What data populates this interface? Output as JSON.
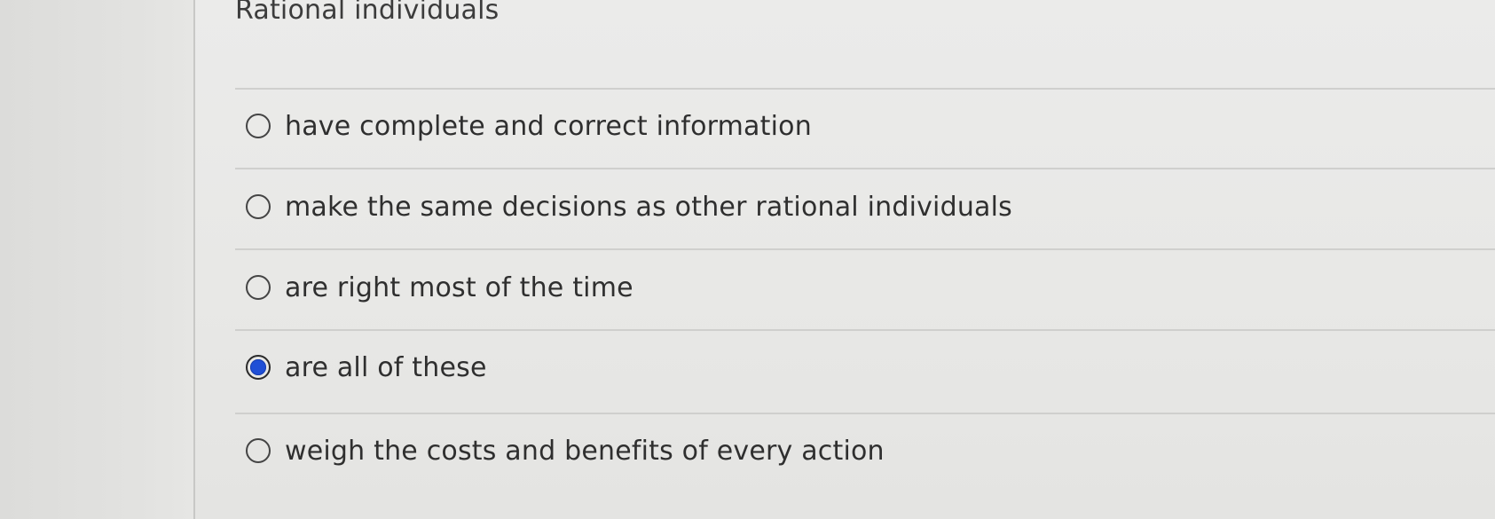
{
  "question": {
    "title": "Rational individuals"
  },
  "options": [
    {
      "label": "have complete and correct information",
      "selected": false
    },
    {
      "label": "make the same decisions as other rational individuals",
      "selected": false
    },
    {
      "label": "are right most of the time",
      "selected": false
    },
    {
      "label": "are all of these",
      "selected": true
    },
    {
      "label": "weigh the costs and benefits of every action",
      "selected": false
    }
  ],
  "colors": {
    "selected_radio": "#1f4fd6",
    "background": "#e8e8e6",
    "text": "#2f2f2f"
  }
}
